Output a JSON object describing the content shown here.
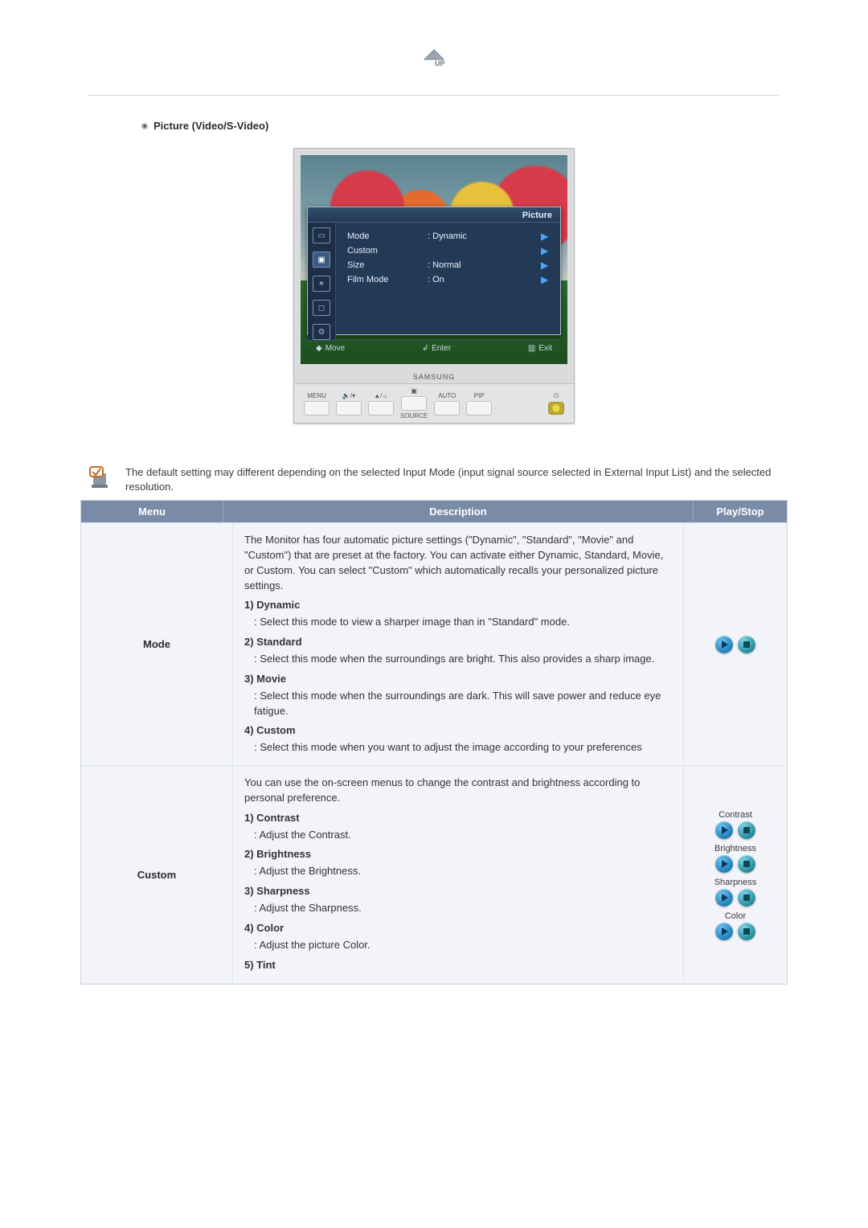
{
  "up_icon": {
    "label": "UP"
  },
  "section_title": "Picture (Video/S-Video)",
  "osd": {
    "title": "Picture",
    "rows": [
      {
        "label": "Mode",
        "value": ": Dynamic"
      },
      {
        "label": "Custom",
        "value": ""
      },
      {
        "label": "Size",
        "value": ": Normal"
      },
      {
        "label": "Film Mode",
        "value": ": On"
      }
    ],
    "footer": {
      "move": "Move",
      "enter": "Enter",
      "exit": "Exit"
    },
    "brand": "SAMSUNG",
    "buttons": {
      "menu": "MENU",
      "source": "SOURCE",
      "auto": "AUTO",
      "pip": "PIP",
      "power": "⏻"
    }
  },
  "note": "The default setting may different depending on the selected Input Mode (input signal source selected in External Input List) and the selected resolution.",
  "table": {
    "headers": {
      "menu": "Menu",
      "desc": "Description",
      "play": "Play/Stop"
    },
    "rows": [
      {
        "menu": "Mode",
        "desc": {
          "intro": "The Monitor has four automatic picture settings (\"Dynamic\", \"Standard\", \"Movie\" and \"Custom\") that are preset at the factory. You can activate either Dynamic, Standard, Movie, or Custom. You can select \"Custom\" which automatically recalls your personalized picture settings.",
          "items": [
            {
              "title": "1) Dynamic",
              "text": ": Select this mode to view a sharper image than in \"Standard\" mode."
            },
            {
              "title": "2) Standard",
              "text": ": Select this mode when the surroundings are bright. This also provides a sharp image."
            },
            {
              "title": "3) Movie",
              "text": ": Select this mode when the surroundings are dark. This will save power and reduce eye fatigue."
            },
            {
              "title": "4) Custom",
              "text": ": Select this mode when you want to adjust the image according to your preferences"
            }
          ]
        },
        "play": {
          "type": "single"
        }
      },
      {
        "menu": "Custom",
        "desc": {
          "intro": "You can use the on-screen menus to change the contrast and brightness according to personal preference.",
          "items": [
            {
              "title": "1) Contrast",
              "text": ": Adjust the Contrast."
            },
            {
              "title": "2) Brightness",
              "text": ": Adjust the Brightness."
            },
            {
              "title": "3) Sharpness",
              "text": ": Adjust the Sharpness."
            },
            {
              "title": "4) Color",
              "text": ": Adjust the picture Color."
            },
            {
              "title": "5) Tint",
              "text": ""
            }
          ]
        },
        "play": {
          "type": "multi",
          "groups": [
            "Contrast",
            "Brightness",
            "Sharpness",
            "Color"
          ]
        }
      }
    ]
  }
}
